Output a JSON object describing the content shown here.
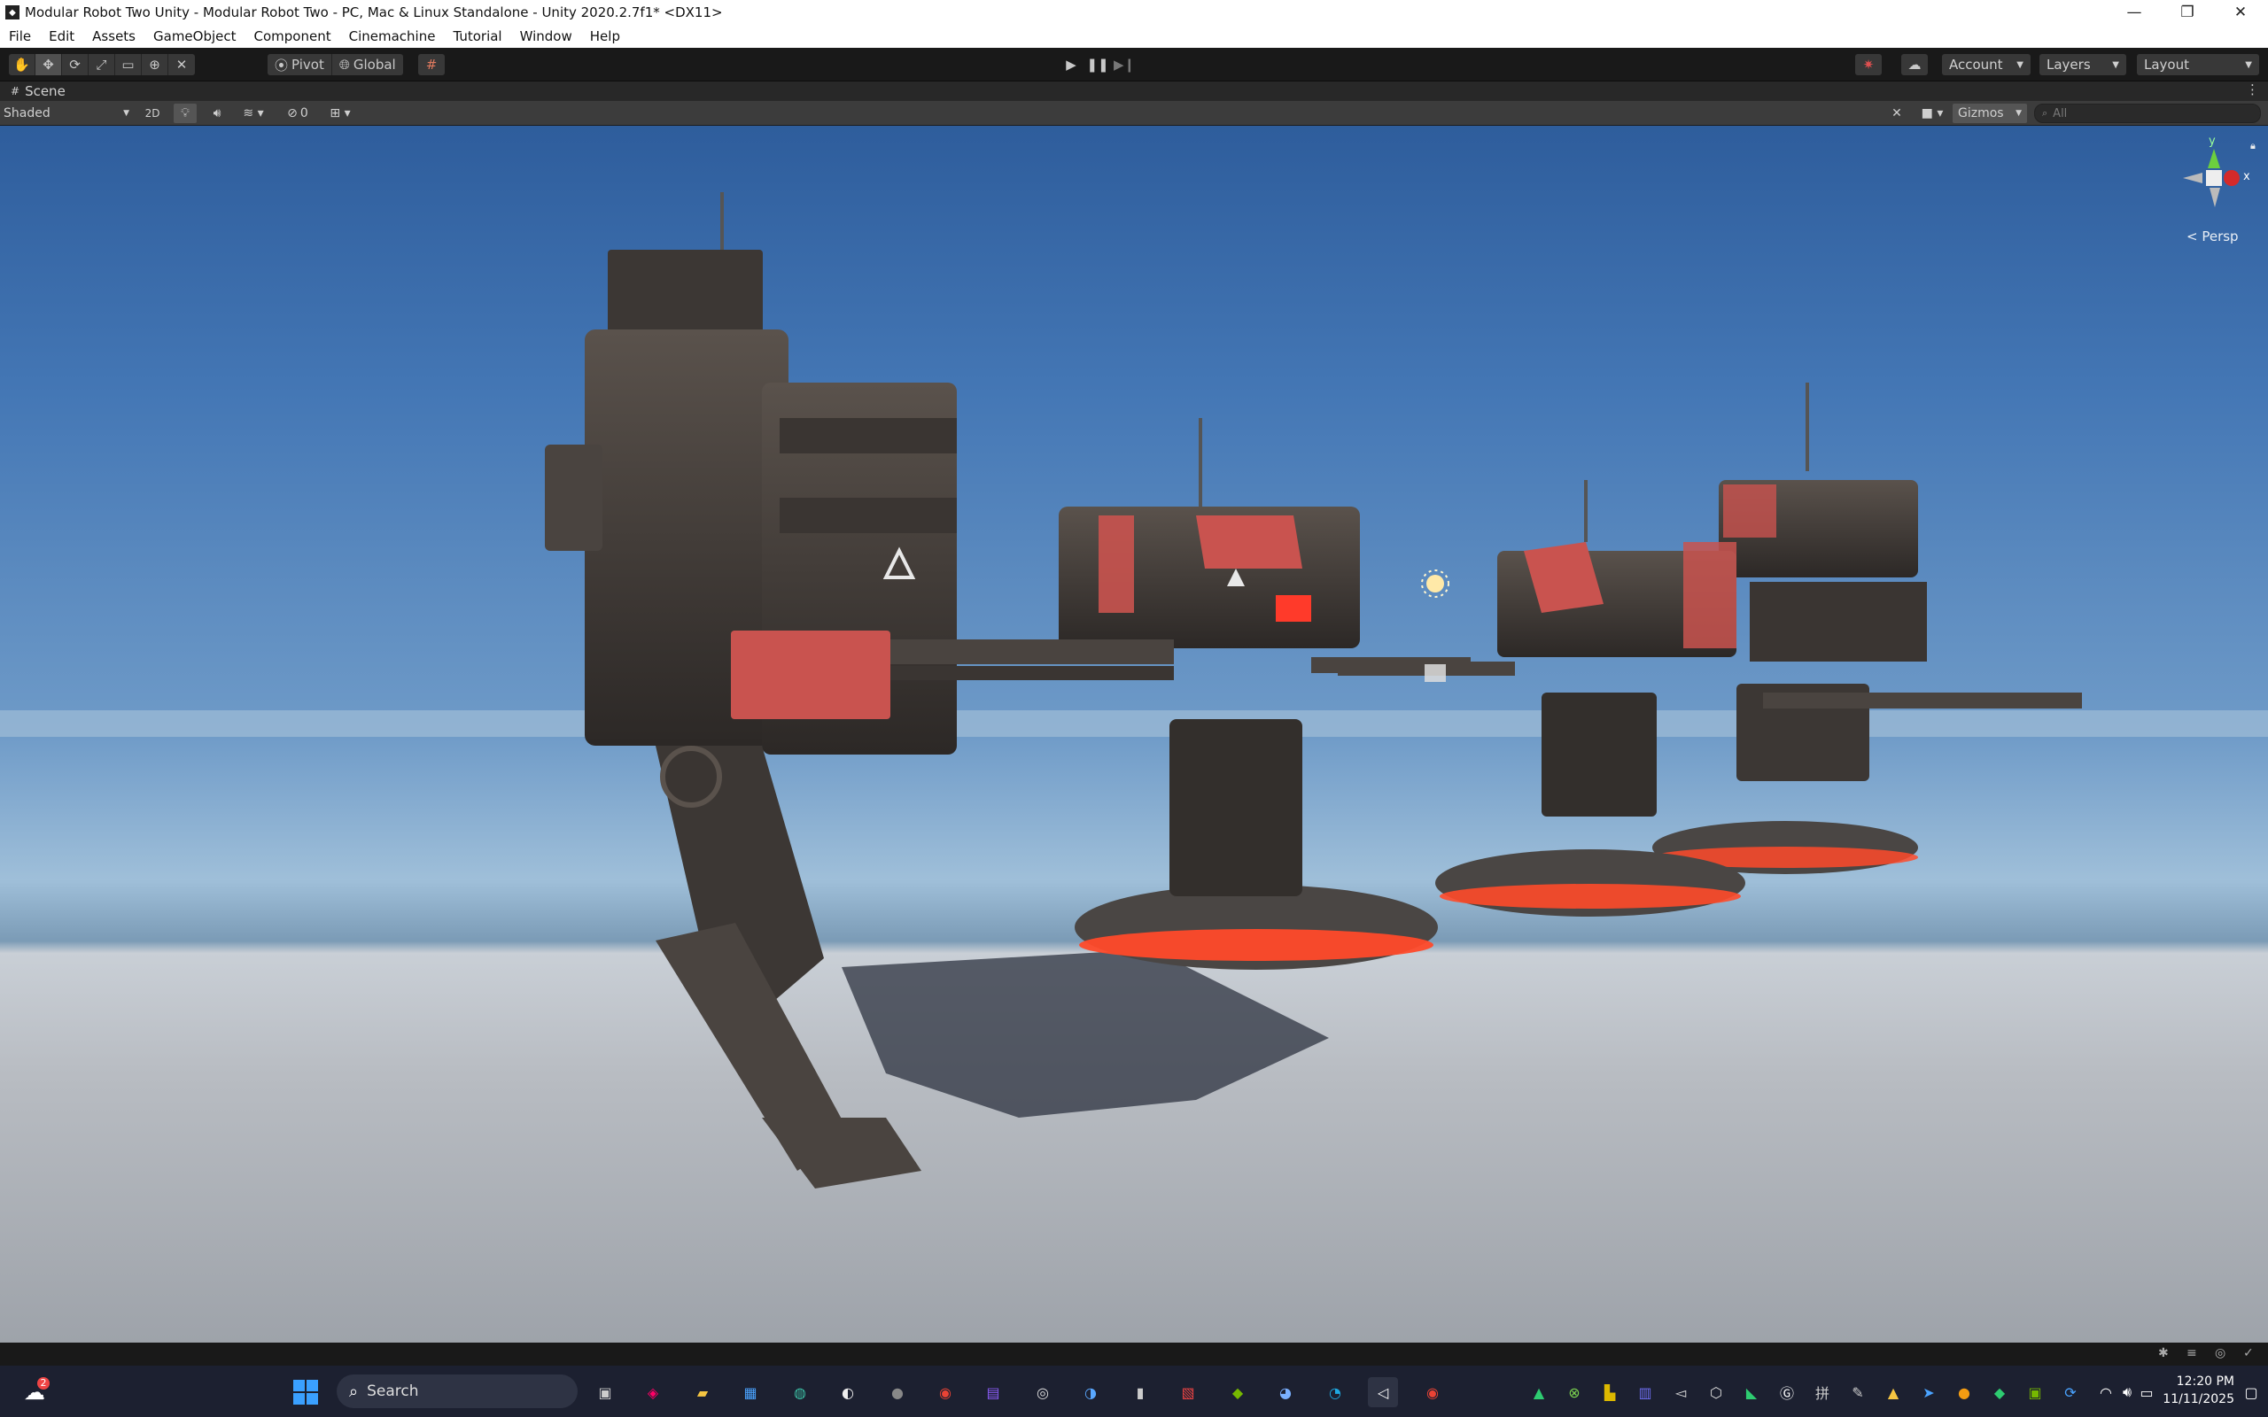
{
  "window": {
    "title": "Modular Robot Two Unity - Modular Robot Two - PC, Mac & Linux Standalone - Unity 2020.2.7f1* <DX11>",
    "minimize_glyph": "—",
    "maximize_glyph": "❐",
    "close_glyph": "✕"
  },
  "menu": [
    "File",
    "Edit",
    "Assets",
    "GameObject",
    "Component",
    "Cinemachine",
    "Tutorial",
    "Window",
    "Help"
  ],
  "toolbar": {
    "pivot_label": "Pivot",
    "global_label": "Global",
    "account_label": "Account",
    "layers_label": "Layers",
    "layout_label": "Layout"
  },
  "scene_tab": {
    "label": "Scene"
  },
  "scene_bar": {
    "shading_mode": "Shaded",
    "mode_2d": "2D",
    "hidden_count": "0",
    "gizmos_label": "Gizmos",
    "search_placeholder": "All"
  },
  "orientation_gizmo": {
    "y_label": "y",
    "x_label": "x",
    "projection_label": "< Persp"
  },
  "taskbar": {
    "search_placeholder": "Search",
    "weather_badge": "2",
    "time": "12:20 PM",
    "date": "11/11/2025"
  },
  "colors": {
    "accent_red": "#c9534f",
    "glow_orange": "#ff4a2a",
    "unity_dark": "#191919"
  }
}
